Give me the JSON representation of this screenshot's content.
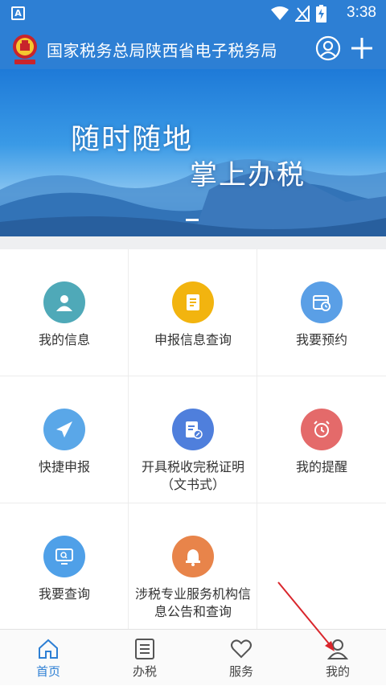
{
  "status_bar": {
    "app_badge": "A",
    "time": "3:38",
    "icons": [
      "wifi-icon",
      "no-signal-icon",
      "battery-charging-icon"
    ]
  },
  "header": {
    "title": "国家税务总局陕西省电子税务局",
    "emblem": "tax-emblem-icon",
    "actions": [
      "user-icon",
      "plus-icon"
    ]
  },
  "banner": {
    "line1": "随时随地",
    "line2": "掌上办税"
  },
  "grid": [
    {
      "label": "我的信息",
      "icon": "user-icon",
      "color": "#4fa9b8"
    },
    {
      "label": "申报信息查询",
      "icon": "document-list-icon",
      "color": "#f2b40f"
    },
    {
      "label": "我要预约",
      "icon": "calendar-clock-icon",
      "color": "#5a9fe6"
    },
    {
      "label": "快捷申报",
      "icon": "paper-plane-icon",
      "color": "#5aa7e8"
    },
    {
      "label": "开具税收完税证明（文书式）",
      "icon": "document-edit-icon",
      "color": "#4f7fdc"
    },
    {
      "label": "我的提醒",
      "icon": "alarm-clock-icon",
      "color": "#e46a6a"
    },
    {
      "label": "我要查询",
      "icon": "monitor-search-icon",
      "color": "#4fa0e8"
    },
    {
      "label": "涉税专业服务机构信息公告和查询",
      "icon": "bell-icon",
      "color": "#e8844a"
    }
  ],
  "tabs": [
    {
      "label": "首页",
      "icon": "home-icon",
      "active": true
    },
    {
      "label": "办税",
      "icon": "list-icon",
      "active": false
    },
    {
      "label": "服务",
      "icon": "heart-icon",
      "active": false
    },
    {
      "label": "我的",
      "icon": "user-outline-icon",
      "active": false
    }
  ],
  "colors": {
    "brand": "#2d7fd4",
    "annotation_arrow": "#d9262c"
  }
}
